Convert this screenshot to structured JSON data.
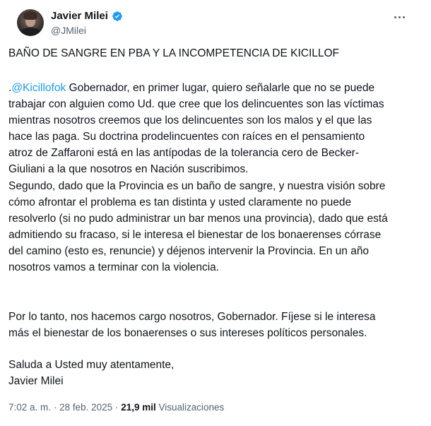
{
  "author": {
    "display_name": "Javier Milei",
    "handle": "@JMilei",
    "avatar_icon": "user-avatar",
    "verified_icon": "verified-badge-icon",
    "verified_color": "#1d9bf0"
  },
  "more_icon": "more-horizontal-icon",
  "tweet": {
    "headline": "BAÑO DE SANGRE EN PBA Y LA INCOMPETENCIA DE KICILLOF",
    "p1_prefix": ".",
    "mention": "@Kicillofok",
    "p1_lines": [
      " Gobernador, en primer lugar, quiero señalarle que no se puede",
      "trabajar con alguien como Ud. que cree que los delincuentes son las víctimas",
      "mientras nosotros creemos que los delincuentes son los malos y el que las",
      "hace las paga. Su doctrina prodelincuentes con raíces en el pensamiento",
      "atroz de Zaffaroni está en las antípodas de la tolerancia cero de Becker-",
      "Giuliani a la que nosotros en Nación suscribimos."
    ],
    "p2_lines": [
      "Segundo, dado que la Provincia es un baño de sangre, y nuestra visión sobre",
      "cómo afrontar el problema es tan distinta y usted claramente no puede",
      "resolverlo (si no pudo administrar un bar menos una provincia), dado que está",
      "admitiendo su fracaso, si le interesa el bienestar de los bonaerenses córrase",
      "del camino (esto es, renuncie) y déjenos intervenir la Provincia. En un año",
      "nosotros vamos a terminar con la violencia."
    ],
    "p3_lines": [
      "Por lo tanto, nos hacemos cargo nosotros, Gobernador. Fíjese si le interesa",
      "más el bienestar de los bonaerenses o sus intereses políticos personales."
    ],
    "p4_lines": [
      "Saluda a Usted muy atentamente,",
      "Javier Milei"
    ]
  },
  "meta": {
    "time": "7:02 a. m.",
    "separator": "·",
    "date": "28 feb. 2025",
    "views_count": "21,9 mil",
    "views_label": "Visualizaciones"
  },
  "colors": {
    "text": "#0f1419",
    "secondary": "#536471",
    "link": "#1d9bf0"
  }
}
